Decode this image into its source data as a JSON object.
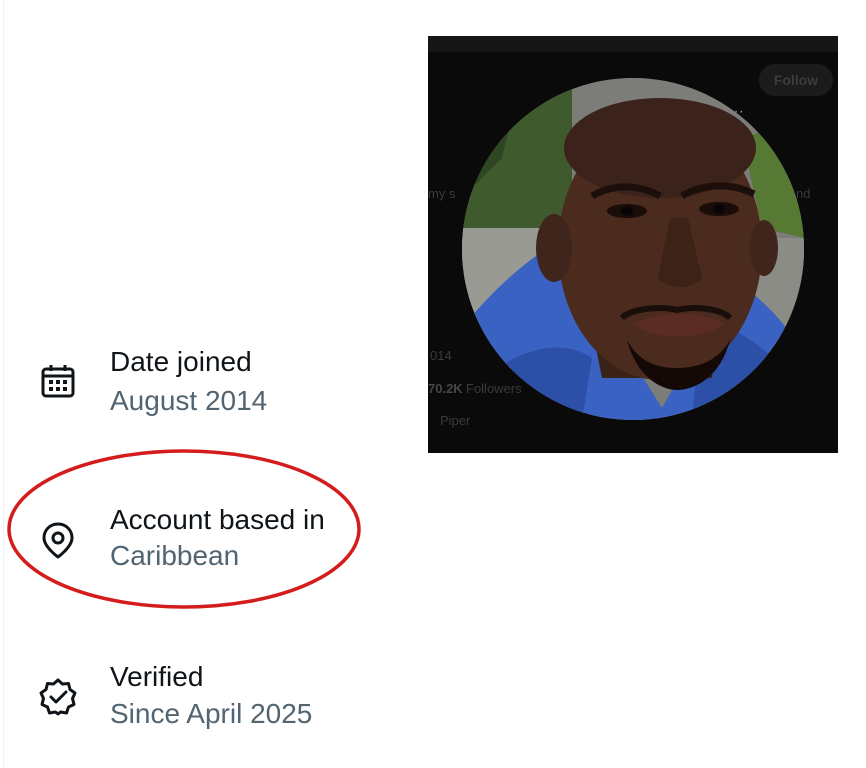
{
  "profile_card": {
    "follow_label": "Follow",
    "more_label": "···",
    "bio_fragment_left": "my s",
    "bio_fragment_right": "nd",
    "joined_fragment": "014",
    "followers_count": "70.2K",
    "followers_label": "Followers",
    "extra_fragment": "Piper"
  },
  "info_rows": [
    {
      "icon": "calendar-icon",
      "title": "Date joined",
      "value": "August 2014"
    },
    {
      "icon": "location-pin-icon",
      "title": "Account based in",
      "value": "Caribbean"
    },
    {
      "icon": "verified-badge-icon",
      "title": "Verified",
      "value": "Since April 2025"
    }
  ],
  "colors": {
    "primary_text": "#0f1419",
    "secondary_text": "#536471",
    "annotation_red": "#d41c1c",
    "card_background": "#0a0a0a"
  }
}
